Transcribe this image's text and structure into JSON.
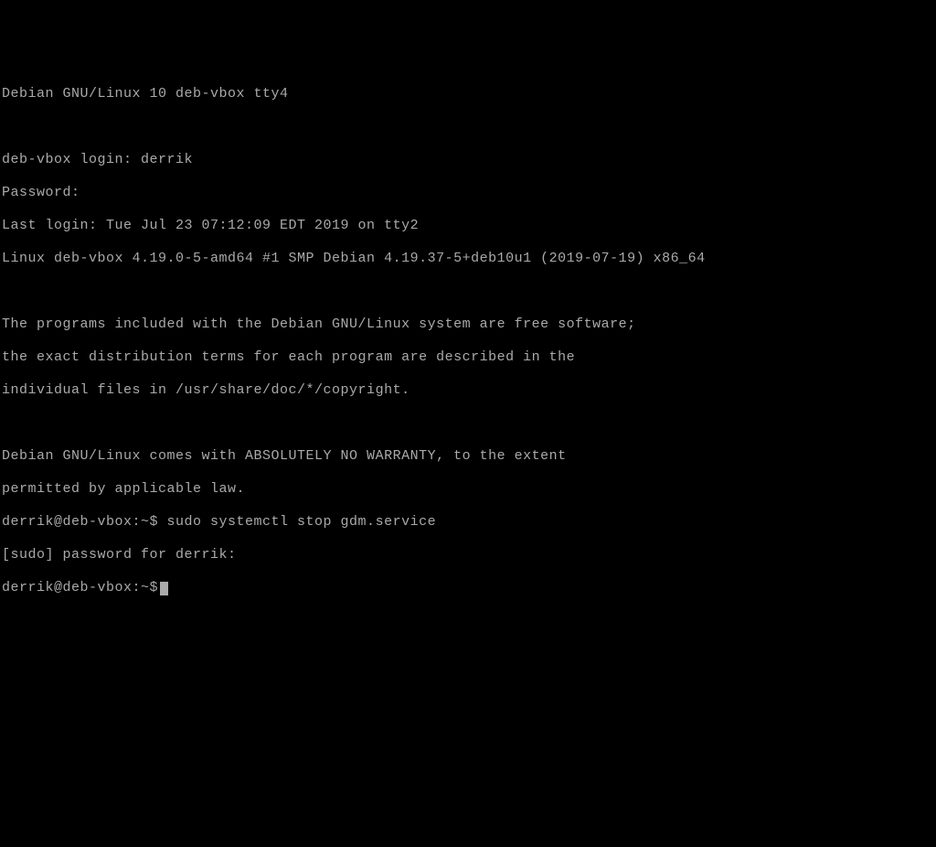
{
  "tty_header": "Debian GNU/Linux 10 deb-vbox tty4",
  "login_prompt": "deb-vbox login: derrik",
  "password_prompt": "Password:",
  "last_login": "Last login: Tue Jul 23 07:12:09 EDT 2019 on tty2",
  "kernel_line": "Linux deb-vbox 4.19.0-5-amd64 #1 SMP Debian 4.19.37-5+deb10u1 (2019-07-19) x86_64",
  "motd_line1": "The programs included with the Debian GNU/Linux system are free software;",
  "motd_line2": "the exact distribution terms for each program are described in the",
  "motd_line3": "individual files in /usr/share/doc/*/copyright.",
  "motd_line4": "Debian GNU/Linux comes with ABSOLUTELY NO WARRANTY, to the extent",
  "motd_line5": "permitted by applicable law.",
  "prompt1": "derrik@deb-vbox:~$ sudo systemctl stop gdm.service",
  "sudo_prompt": "[sudo] password for derrik:",
  "prompt2": "derrik@deb-vbox:~$"
}
